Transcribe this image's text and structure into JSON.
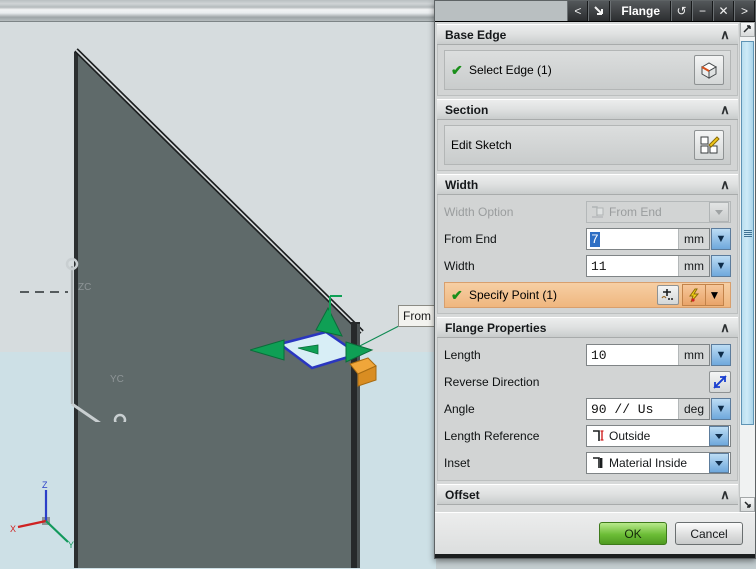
{
  "app": {
    "accent_blue": "#2f6fc4",
    "body_color": "#5f6a6a",
    "floor_color": "#cde0e6",
    "warm_highlight": "#efb77f",
    "ok_green": "#6cbd36"
  },
  "titlebar": {
    "back_label": "<",
    "pin_icon": "arrow-icon",
    "title": "Flange",
    "reset_label": "↺",
    "minimize_label": "−",
    "close_label": "✕",
    "forward_label": ">"
  },
  "viewport": {
    "callout_label": "From",
    "datum_labels": [
      "ZC",
      "YC"
    ],
    "triad_labels": [
      "Z",
      "X",
      "Y"
    ]
  },
  "sections": [
    {
      "id": "base-edge",
      "title": "Base Edge",
      "collapse_glyph": "∧",
      "select_label": "Select Edge (1)",
      "check_glyph": "✔",
      "icon": "select-edge-cube-icon"
    },
    {
      "id": "section",
      "title": "Section",
      "collapse_glyph": "∧",
      "edit_label": "Edit Sketch",
      "icon": "edit-sketch-icon"
    },
    {
      "id": "width",
      "title": "Width",
      "collapse_glyph": "∧",
      "fields": [
        {
          "label": "Width Option",
          "type": "combo",
          "value": "From End",
          "icon": "from-end-icon",
          "disabled": true
        },
        {
          "label": "From End",
          "type": "number",
          "value": "7",
          "unit": "mm",
          "selected": true
        },
        {
          "label": "Width",
          "type": "number",
          "value": "11",
          "unit": "mm",
          "selected": false
        }
      ],
      "specify_point": {
        "label": "Specify Point (1)",
        "check_glyph": "✔",
        "point_icon": "point-constructor-icon",
        "snap_icon": "snap-point-icon",
        "snap_arrow_glyph": "▼"
      }
    },
    {
      "id": "flange-properties",
      "title": "Flange Properties",
      "collapse_glyph": "∧",
      "fields": [
        {
          "label": "Length",
          "type": "number",
          "value": "10",
          "unit": "mm"
        },
        {
          "label": "Reverse Direction",
          "type": "iconbutton",
          "icon": "reverse-direction-icon"
        },
        {
          "label": "Angle",
          "type": "number",
          "value": "90  //  Us",
          "unit": "deg"
        },
        {
          "label": "Length Reference",
          "type": "combo",
          "value": "Outside",
          "icon": "length-reference-icon"
        },
        {
          "label": "Inset",
          "type": "combo",
          "value": "Material Inside",
          "icon": "inset-icon"
        }
      ]
    },
    {
      "id": "offset",
      "title": "Offset",
      "collapse_glyph": "∧"
    }
  ],
  "scrollbar": {
    "up_glyph": "▲",
    "down_glyph": "▼"
  },
  "footer": {
    "ok_label": "OK",
    "cancel_label": "Cancel"
  }
}
